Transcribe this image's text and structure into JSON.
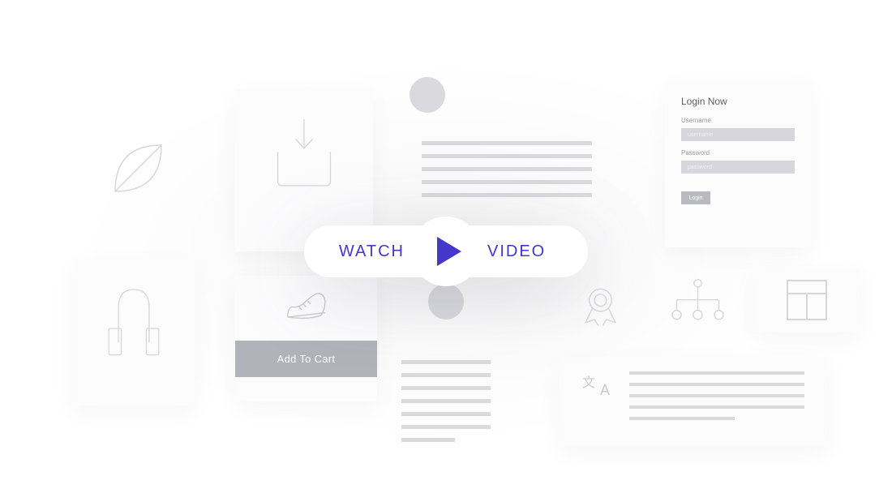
{
  "cta": {
    "watch": "WATCH",
    "video": "VIDEO"
  },
  "login_card": {
    "title": "Login Now",
    "username_label": "Username",
    "username_placeholder": "username",
    "password_label": "Password",
    "password_placeholder": "password",
    "button": "Login"
  },
  "shoe_card": {
    "add_to_cart": "Add To Cart"
  },
  "translate_card": {
    "char1": "文",
    "char2": "A"
  },
  "icons": {
    "leaf": "leaf-icon",
    "download": "download-icon",
    "chair": "chair-icon",
    "ribbon": "ribbon-icon",
    "org": "org-chart-icon",
    "layout": "layout-grid-icon",
    "shoe": "sneaker-icon",
    "play": "play-icon"
  }
}
